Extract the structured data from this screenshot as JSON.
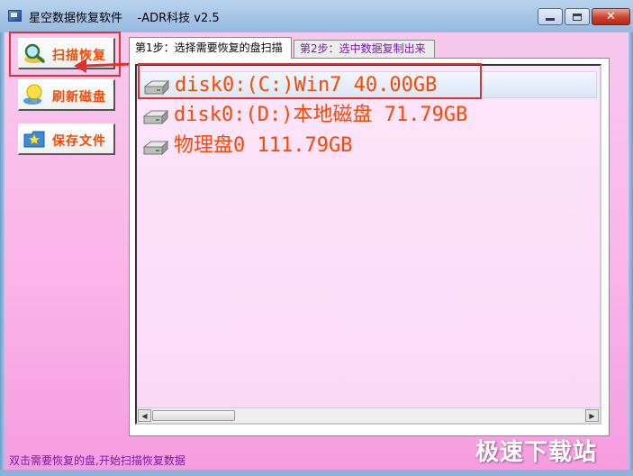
{
  "window": {
    "title": "星空数据恢复软件    -ADR科技 v2.5",
    "controls": {
      "minimize": "minimize-icon",
      "maximize": "maximize-icon",
      "close": "close-icon"
    }
  },
  "sidebar": {
    "buttons": [
      {
        "label": "扫描恢复",
        "icon": "magnifier-icon"
      },
      {
        "label": "刷新磁盘",
        "icon": "lightbulb-icon"
      },
      {
        "label": "保存文件",
        "icon": "folder-star-icon"
      }
    ]
  },
  "tabs": [
    {
      "label": "第1步：选择需要恢复的盘扫描",
      "active": true
    },
    {
      "label": "第2步：选中数据复制出来",
      "active": false
    }
  ],
  "disk_list": [
    {
      "label": "disk0:(C:)Win7 40.00GB",
      "selected": true,
      "icon": "hard-drive-icon"
    },
    {
      "label": "disk0:(D:)本地磁盘 71.79GB",
      "selected": false,
      "icon": "hard-drive-icon"
    },
    {
      "label": "物理盘0 111.79GB",
      "selected": false,
      "icon": "hard-drive-icon"
    }
  ],
  "status_bar": {
    "text": "双击需要恢复的盘,开始扫描恢复数据"
  },
  "watermark": {
    "text": "极速下载站"
  },
  "colors": {
    "accent_text": "#ff4500",
    "annotation": "#e03030",
    "client_bg": "#f7c9ee",
    "status_text": "#7a1aa8"
  }
}
